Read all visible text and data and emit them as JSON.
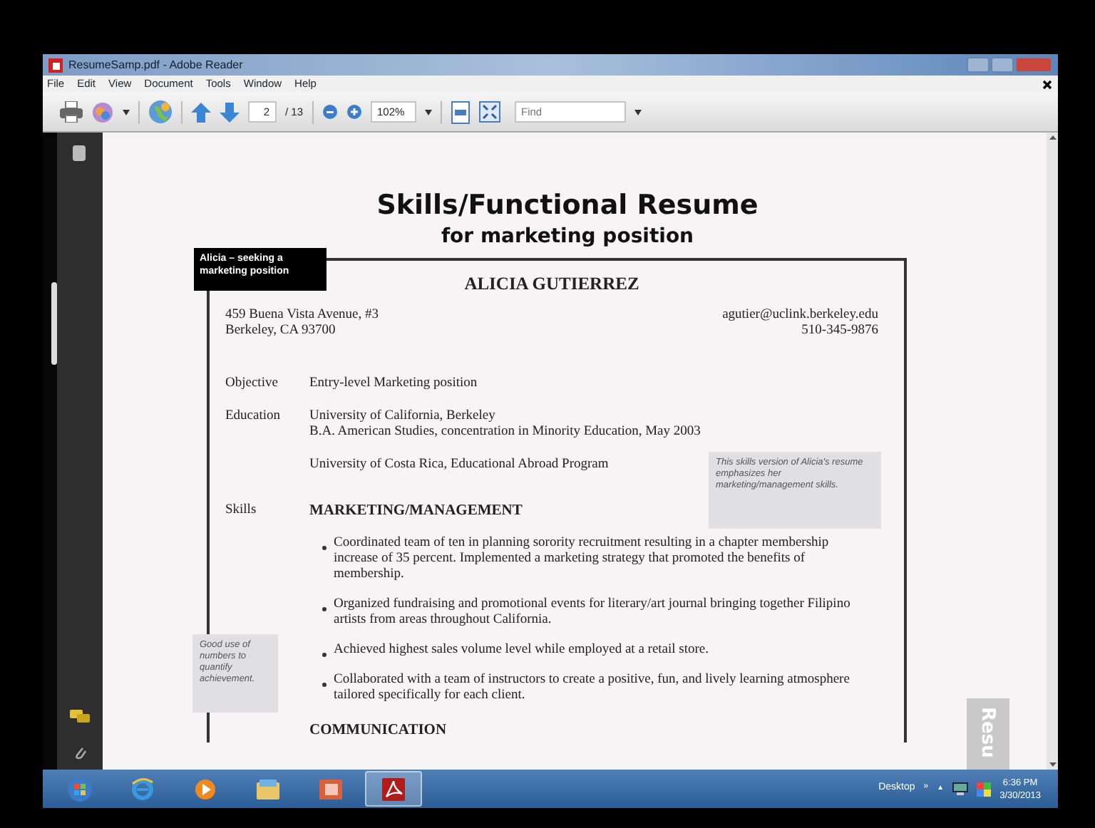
{
  "window": {
    "title": "ResumeSamp.pdf - Adobe Reader"
  },
  "menu": [
    "File",
    "Edit",
    "View",
    "Document",
    "Tools",
    "Window",
    "Help"
  ],
  "toolbar": {
    "page_field": "2",
    "page_count": "/ 13",
    "zoom_field": "102%",
    "find": {
      "placeholder": "Find"
    }
  },
  "document": {
    "title": "Skills/Functional Resume",
    "subtitle": "for marketing position",
    "callout": "Alicia – seeking a marketing position",
    "name": "ALICIA GUTIERREZ",
    "address": [
      "459 Buena Vista Avenue, #3",
      "Berkeley, CA 93700"
    ],
    "contact": [
      "agutier@uclink.berkeley.edu",
      "510-345-9876"
    ],
    "sections": [
      {
        "label": "Objective",
        "lines": [
          "Entry-level Marketing position"
        ]
      },
      {
        "label": "Education",
        "lines": [
          "University of California, Berkeley",
          "B.A. American Studies, concentration in Minority Education, May 2003"
        ]
      },
      {
        "lines": [
          "University of Costa Rica, Educational Abroad Program"
        ]
      }
    ],
    "skills_label": "Skills",
    "skills_heading": "MARKETING/MANAGEMENT",
    "bullets": [
      "Coordinated team of ten in planning sorority recruitment resulting in a chapter membership increase of 35 percent.  Implemented a marketing strategy that promoted the benefits of membership.",
      "Organized fundraising and promotional events for literary/art journal bringing together Filipino artists from areas throughout California.",
      "Achieved highest sales volume level while employed at a retail store.",
      "Collaborated with a team of instructors to create a positive, fun, and lively learning atmosphere tailored specifically for each client."
    ],
    "next_heading": "COMMUNICATION",
    "note_right": "This skills version of Alicia's resume emphasizes her marketing/management skills.",
    "note_left": "Good use of numbers to quantify achievement.",
    "side_tab": "Resu"
  },
  "taskbar": {
    "apps": [
      {
        "kind": "start",
        "selected": false
      },
      {
        "kind": "browser",
        "selected": false
      },
      {
        "kind": "media",
        "selected": false
      },
      {
        "kind": "folder",
        "selected": false
      },
      {
        "kind": "slides",
        "selected": false
      },
      {
        "kind": "pdf",
        "selected": true
      }
    ],
    "desktop_label": "Desktop",
    "chevron": "»",
    "tray_arrow": "▲",
    "time": "6:36 PM",
    "date": "3/30/2013"
  }
}
